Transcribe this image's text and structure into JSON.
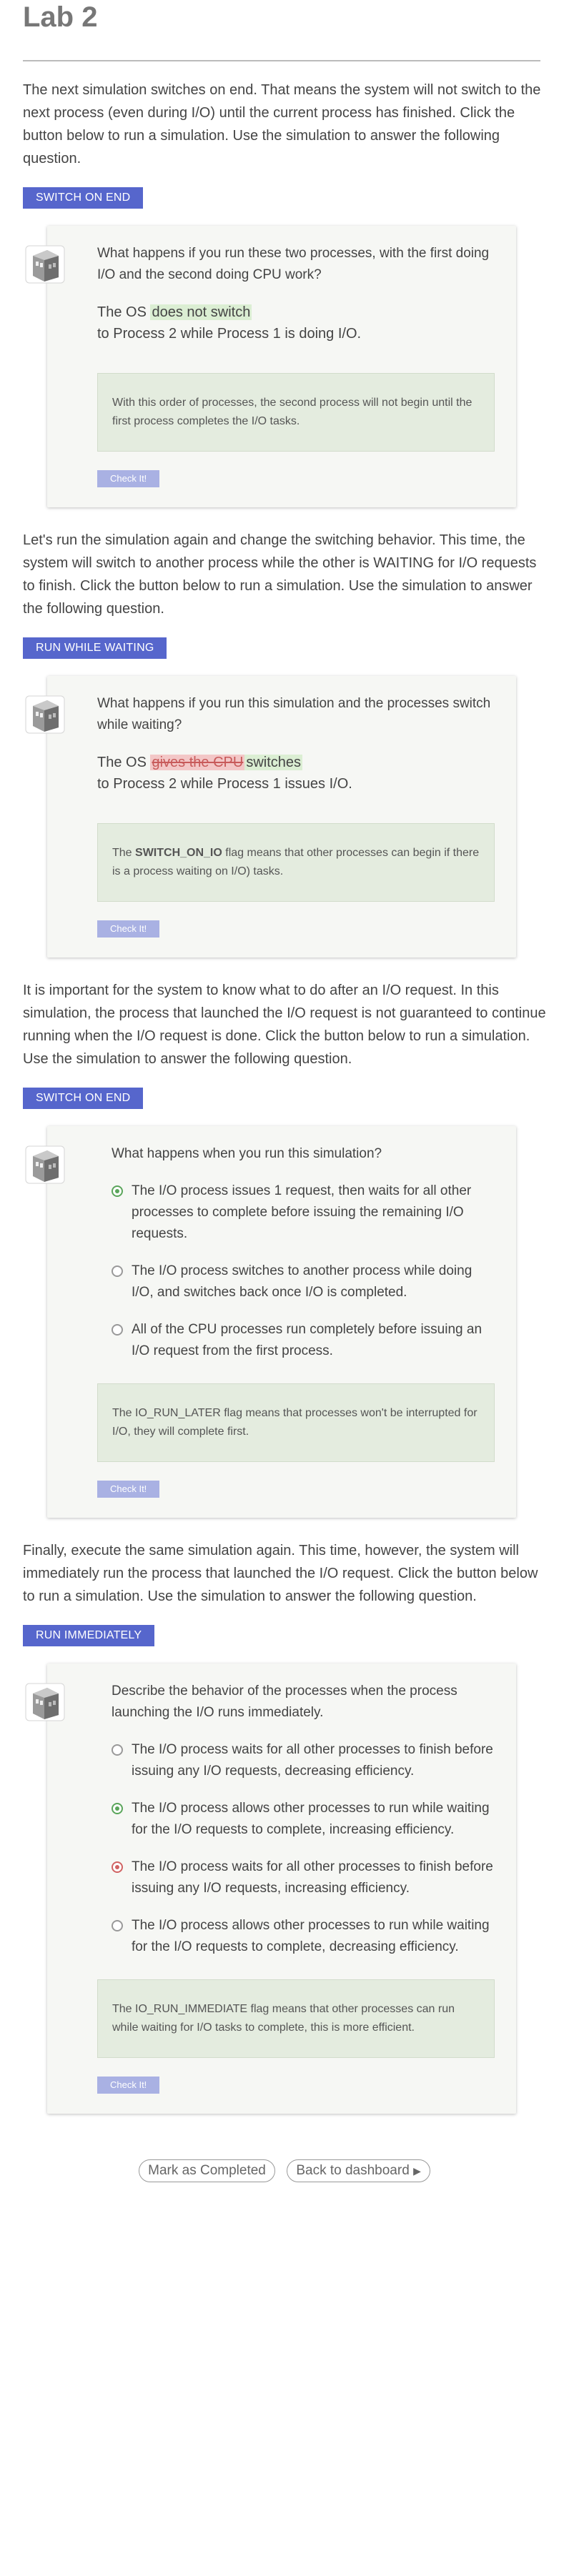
{
  "lab": {
    "title": "Lab 2"
  },
  "section1": {
    "intro": "The next simulation switches on end. That means the system will not switch to the next process (even during I/O) until the current process has finished. Click the button below to run a simulation. Use the simulation to answer the following question.",
    "button": "SWITCH ON END",
    "question": "What happens if you run these two processes, with the first doing I/O and the second doing CPU work?",
    "fill_prefix": "The OS",
    "fill_answer": "does not switch",
    "fill_suffix": "to Process 2 while Process 1 is doing I/O.",
    "feedback": "With this order of processes, the second process will not begin until the first process completes the I/O tasks.",
    "check": "Check It!"
  },
  "section2": {
    "intro": "Let's run the simulation again and change the switching behavior. This time, the system will switch to another process while the other is WAITING for I/O requests to finish. Click the button below to run a simulation. Use the simulation to answer the following question.",
    "button": "RUN WHILE WAITING",
    "question": "What happens if you run this simulation and the processes switch while waiting?",
    "fill_prefix": "The OS",
    "fill_wrong": "gives the CPU",
    "fill_right": "switches",
    "fill_suffix": "to Process 2 while Process 1 issues I/O.",
    "feedback_prefix": "The ",
    "feedback_flag": "SWITCH_ON_IO",
    "feedback_suffix": " flag means that other processes can begin if there is a process waiting on I/O) tasks.",
    "check": "Check It!"
  },
  "section3": {
    "intro": "It is important for the system to know what to do after an I/O request. In this simulation, the process that launched the I/O request is not guaranteed to continue running when the I/O request is done. Click the button below to run a simulation. Use the simulation to answer the following question.",
    "button": "SWITCH ON END",
    "question": "What happens when you run this simulation?",
    "options": [
      "The I/O process issues 1 request, then waits for all other processes to complete before issuing the remaining I/O requests.",
      "The I/O process switches to another process while doing I/O, and switches back once I/O is completed.",
      "All of the CPU processes run completely before issuing an I/O request from the first process."
    ],
    "feedback": "The IO_RUN_LATER flag means that processes won't be interrupted for I/O, they will complete first.",
    "check": "Check It!"
  },
  "section4": {
    "intro": "Finally, execute the same simulation again. This time, however, the system will immediately run the process that launched the I/O request. Click the button below to run a simulation. Use the simulation to answer the following question.",
    "button": "RUN IMMEDIATELY",
    "question": "Describe the behavior of the processes when the process launching the I/O runs immediately.",
    "options": [
      "The I/O process waits for all other processes to finish before issuing any I/O requests, decreasing efficiency.",
      "The I/O process allows other processes to run while waiting for the I/O requests to complete, increasing efficiency.",
      "The I/O process waits for all other processes to finish before issuing any I/O requests, increasing efficiency.",
      "The I/O process allows other processes to run while waiting for the I/O requests to complete, decreasing efficiency."
    ],
    "feedback": "The IO_RUN_IMMEDIATE flag means that other processes can run while waiting for I/O tasks to complete, this is more efficient.",
    "check": "Check It!"
  },
  "footer": {
    "mark_completed": "Mark as Completed",
    "back": "Back to dashboard",
    "back_icon": "▶"
  },
  "colors": {
    "accent": "#5666cc",
    "check_button": "#a9b1e3",
    "correct_highlight": "#dbeed3",
    "wrong_highlight": "#f3c7c7"
  }
}
